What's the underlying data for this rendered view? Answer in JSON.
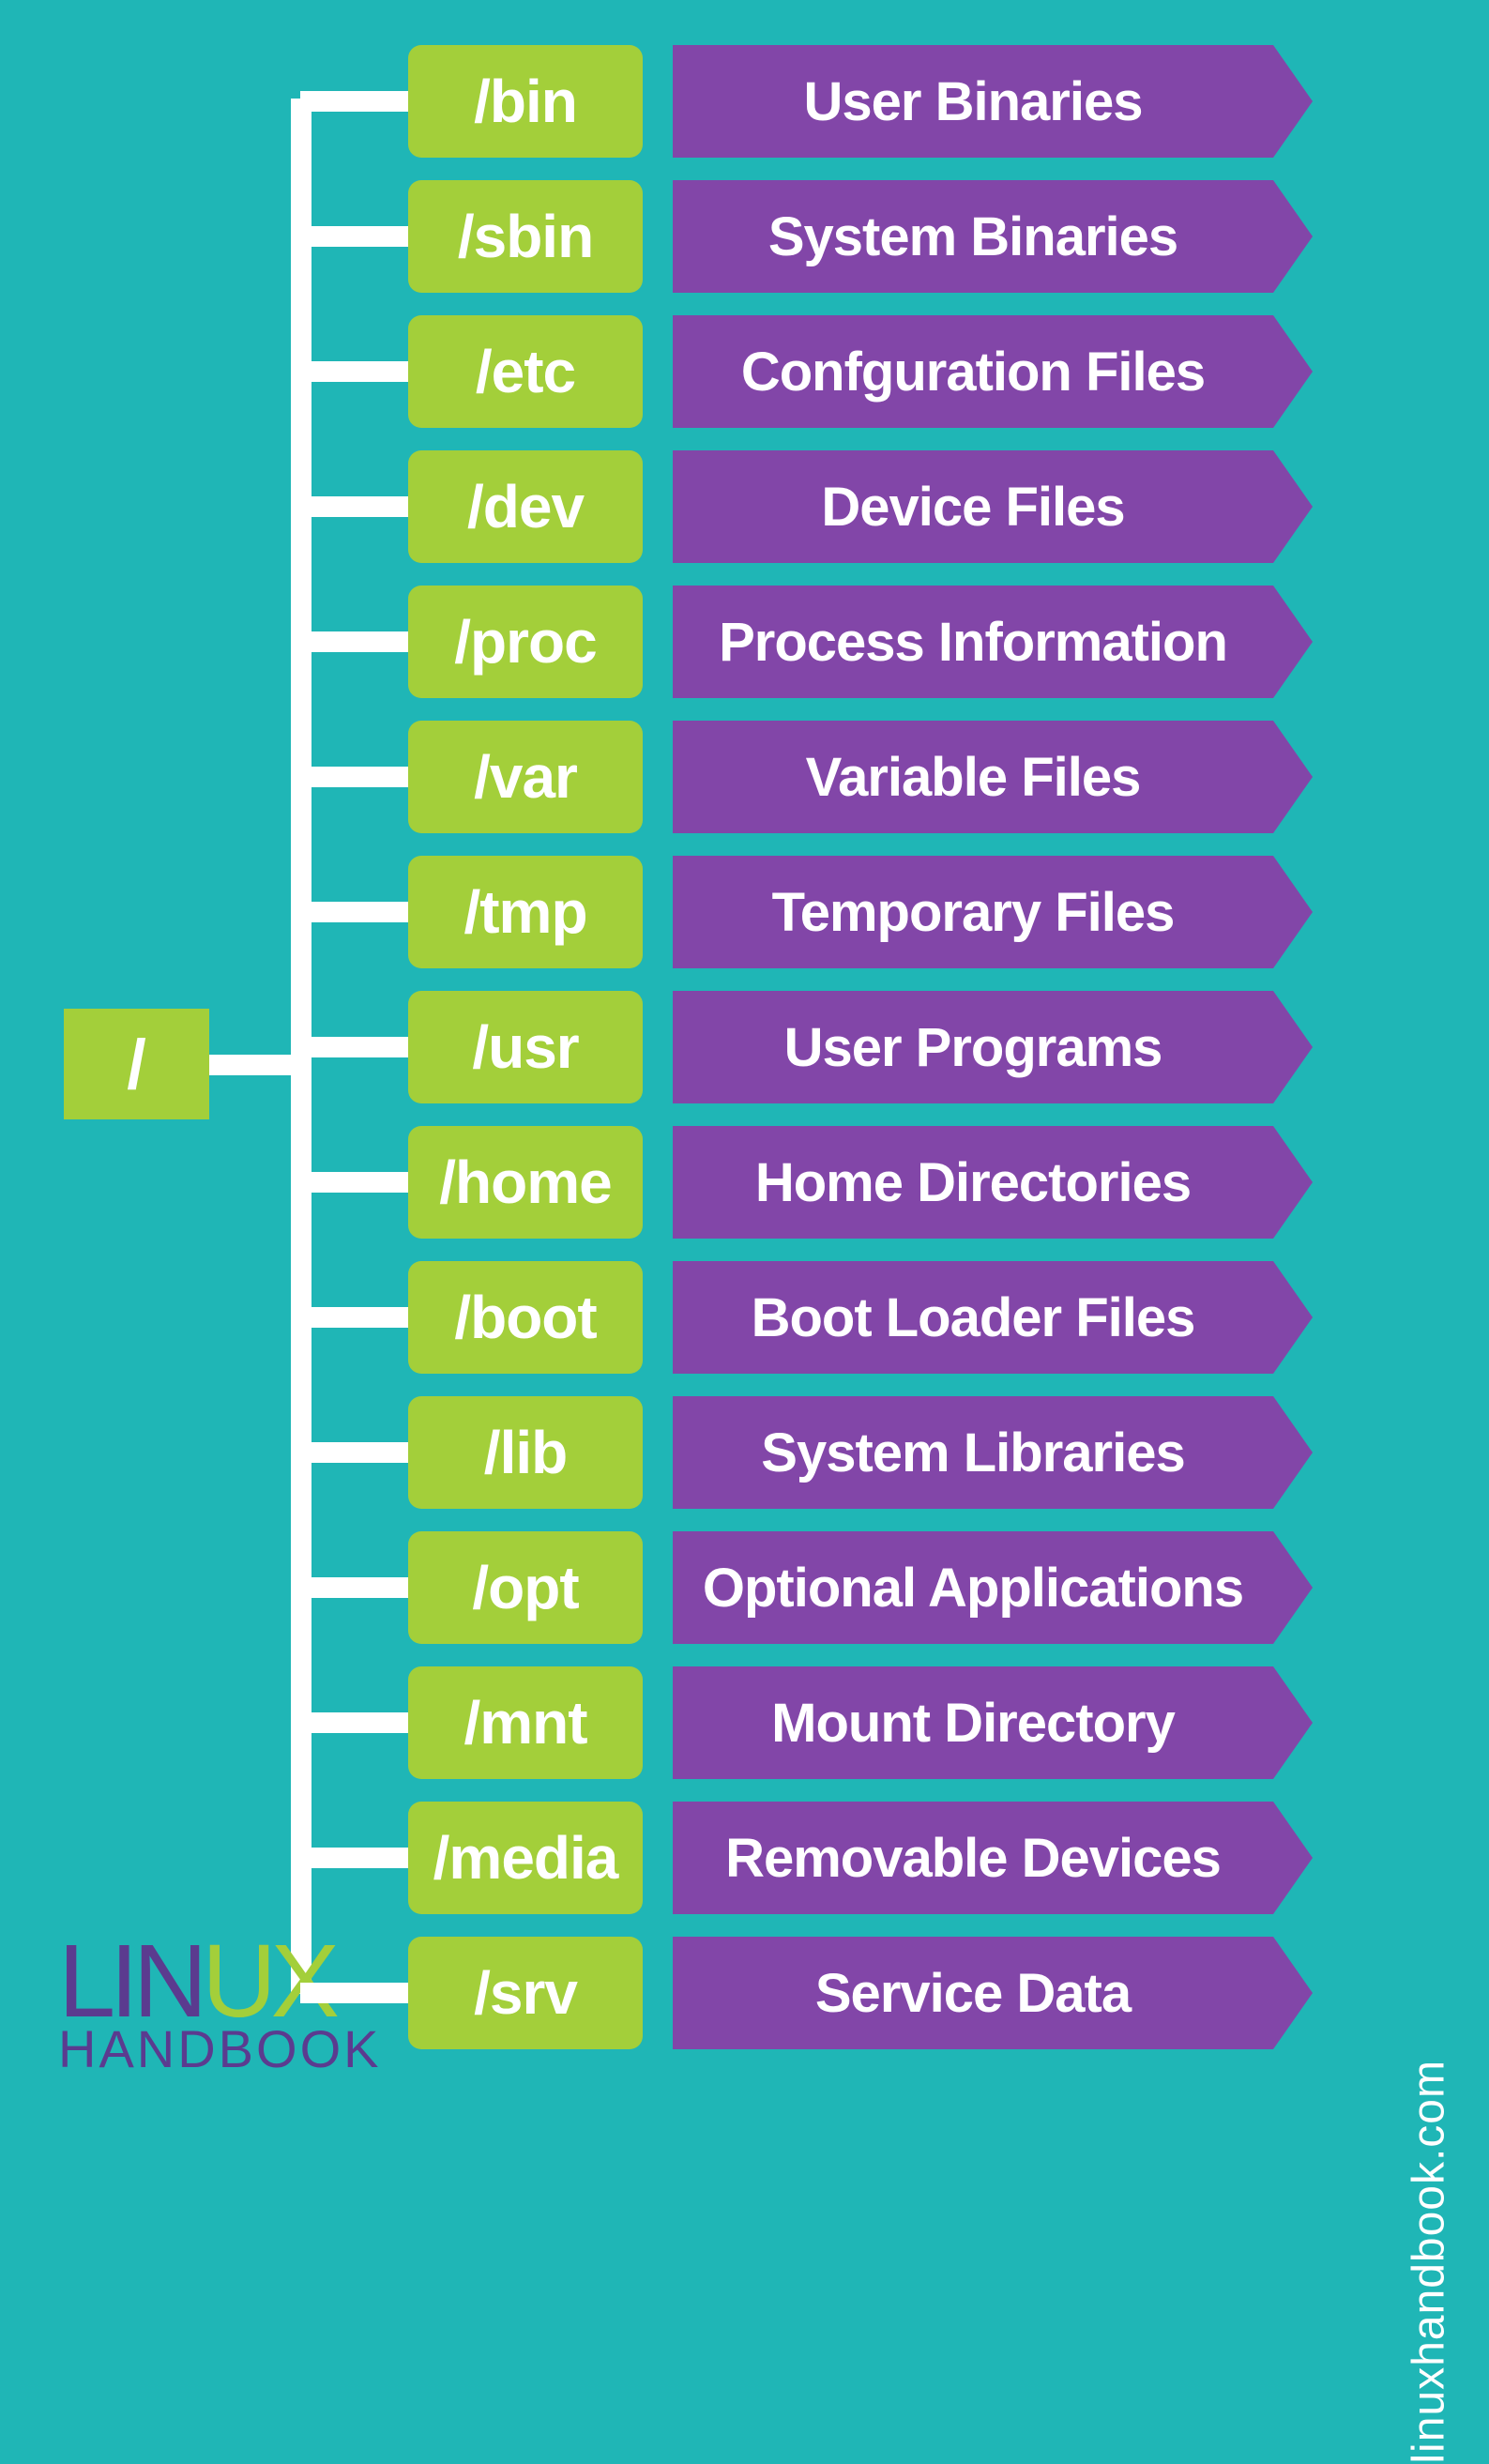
{
  "root": "/",
  "dirs": [
    {
      "name": "/bin",
      "desc": "User Binaries"
    },
    {
      "name": "/sbin",
      "desc": "System Binaries"
    },
    {
      "name": "/etc",
      "desc": "Confguration Files"
    },
    {
      "name": "/dev",
      "desc": "Device Files"
    },
    {
      "name": "/proc",
      "desc": "Process Information"
    },
    {
      "name": "/var",
      "desc": "Variable Files"
    },
    {
      "name": "/tmp",
      "desc": "Temporary Files"
    },
    {
      "name": "/usr",
      "desc": "User Programs"
    },
    {
      "name": "/home",
      "desc": "Home Directories"
    },
    {
      "name": "/boot",
      "desc": "Boot Loader Files"
    },
    {
      "name": "/lib",
      "desc": "System Libraries"
    },
    {
      "name": "/opt",
      "desc": "Optional Applications"
    },
    {
      "name": "/mnt",
      "desc": "Mount Directory"
    },
    {
      "name": "/media",
      "desc": "Removable Devices"
    },
    {
      "name": "/srv",
      "desc": "Service Data"
    }
  ],
  "logo": {
    "line1a": "LIN",
    "line1b": "UX",
    "line2": "HANDBOOK"
  },
  "url": "linuxhandbook.com"
}
